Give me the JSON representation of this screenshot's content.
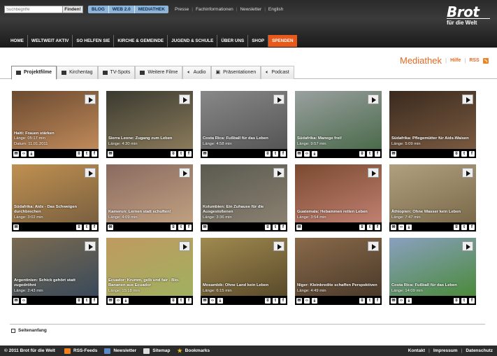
{
  "header": {
    "search": {
      "placeholder": "Suchbegriffe",
      "button": "Finden!"
    },
    "pill": [
      "BLOG",
      "WEB 2.0",
      "MEDIATHEK"
    ],
    "top_links": [
      "Presse",
      "Fachinformationen",
      "Newsletter",
      "English"
    ],
    "logo": {
      "line1": "Brot",
      "line2": "für die Welt"
    },
    "nav": [
      "HOME",
      "WELTWEIT AKTIV",
      "SO HELFEN SIE",
      "KIRCHE & GEMEINDE",
      "JUGEND & SCHULE",
      "ÜBER UNS",
      "SHOP",
      "SPENDEN"
    ]
  },
  "mediathek": {
    "title": "Mediathek",
    "help": "Hilfe",
    "rss": "RSS"
  },
  "tabs": [
    "Projektfilme",
    "Kirchentag",
    "TV-Spots",
    "Weitere Filme",
    "Audio",
    "Präsentationen",
    "Podcast"
  ],
  "videos": [
    {
      "title": "Haiti: Frauen stärken",
      "length": "Länge: 05:17 min",
      "date": "Datum: 11.01.2011",
      "colors": [
        "#6b4a30",
        "#c08a5a"
      ]
    },
    {
      "title": "Sierra Leone: Zugang zum Leben",
      "length": "Länge: 4:30 min",
      "colors": [
        "#3a3a30",
        "#8a7a5a"
      ]
    },
    {
      "title": "Costa Rica: Fußball für das Leben",
      "length": "Länge: 4:58 min",
      "colors": [
        "#888",
        "#555"
      ]
    },
    {
      "title": "Südafrika: Manege frei!",
      "length": "Länge: 9:57 min",
      "colors": [
        "#9aa0a0",
        "#4a6a4a"
      ]
    },
    {
      "title": "Südafrika: Pflegemütter für Aids-Waisen",
      "length": "Länge: 5:09 min",
      "colors": [
        "#3a2a1e",
        "#7a5a40"
      ]
    },
    {
      "title": "Südafrika: Aids - Das Schweigen durchbrechen",
      "length": "Länge: 3:02 min",
      "colors": [
        "#c09050",
        "#7a6040"
      ]
    },
    {
      "title": "Kamerun: Lernen statt schuften!",
      "length": "Länge: 4:09 min",
      "colors": [
        "#8a6a60",
        "#c0a080"
      ]
    },
    {
      "title": "Kolumbien: Ein Zuhause für die Ausgestoßenen",
      "length": "Länge: 3:36 min",
      "colors": [
        "#5a5a50",
        "#8a8070"
      ]
    },
    {
      "title": "Guatemala: Hebammen retten Leben",
      "length": "Länge: 3:54 min",
      "colors": [
        "#7a4a30",
        "#c08070"
      ]
    },
    {
      "title": "Äthiopien: Ohne Wasser kein Leben",
      "length": "Länge: 7:47 min",
      "colors": [
        "#b0a080",
        "#7a6a4a"
      ]
    },
    {
      "title": "Argentinien: Schick gehört statt zugedröhnt",
      "length": "Länge: 2:43 min",
      "colors": [
        "#7a6a50",
        "#3a4a5a"
      ]
    },
    {
      "title": "Ecuador: Krumm, gelb und fair - Bio-Bananen aus Ecuador",
      "length": "Länge: 15:18 min",
      "colors": [
        "#c09a60",
        "#a0b060"
      ]
    },
    {
      "title": "Mosambik: Ohne Land kein Leben",
      "length": "Länge: 6:15 min",
      "colors": [
        "#a08a50",
        "#5a4a2a"
      ]
    },
    {
      "title": "Niger: Kleinkredite schaffen Perspektiven",
      "length": "Länge: 4:49 min",
      "colors": [
        "#8a6a4a",
        "#4a3a2a"
      ]
    },
    {
      "title": "Costa Rica: Fußball für das Leben",
      "length": "Länge: 14:09 min",
      "colors": [
        "#8aa0c0",
        "#4a8a3a"
      ]
    }
  ],
  "bar_icons": {
    "email": "✉",
    "embed": "‹›",
    "download": "⤓",
    "del": "ʬ",
    "twitter": "t",
    "facebook": "f"
  },
  "video_icon_sets": [
    [
      "email",
      "embed",
      "download"
    ],
    [
      "email"
    ],
    [
      "email"
    ],
    [
      "email",
      "embed",
      "download"
    ],
    [
      "email"
    ],
    [
      "email"
    ],
    [
      "email"
    ],
    [
      "email"
    ],
    [
      "email"
    ],
    [
      "email",
      "embed",
      "download"
    ],
    [
      "email",
      "embed"
    ],
    [
      "email",
      "embed",
      "download"
    ],
    [
      "email",
      "embed",
      "download"
    ],
    [
      "email",
      "embed",
      "download"
    ],
    [
      "email",
      "embed",
      "download"
    ]
  ],
  "top_link": "Seitenanfang",
  "footer": {
    "copyright": "© 2011 Brot für die Welt",
    "links": [
      "RSS-Feeds",
      "Newsletter",
      "Sitemap",
      "Bookmarks"
    ],
    "right": [
      "Kontakt",
      "Impressum",
      "Datenschutz"
    ]
  },
  "colors": {
    "accent": "#e26a22",
    "spenden": "#e8591c",
    "pill": "#8fb6d8"
  }
}
